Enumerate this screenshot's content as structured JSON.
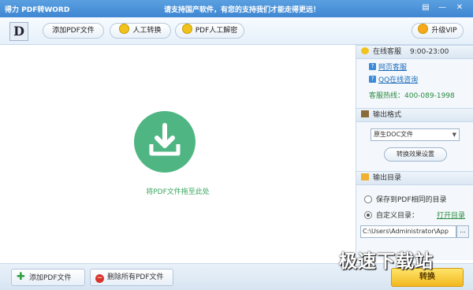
{
  "window": {
    "title": "得力 PDF转WORD",
    "slogan": "请支持国产软件，有您的支持我们才能走得更远！",
    "logo_letter": "D"
  },
  "toolbar": {
    "add_pdf": "添加PDF文件",
    "manual_convert": "人工转换",
    "manual_decrypt": "PDF人工解密",
    "upgrade_vip": "升级VIP"
  },
  "main": {
    "drop_label": "将PDF文件拖至此处",
    "drop_icon": "download-icon"
  },
  "sidebar": {
    "service": {
      "title": "在线客服",
      "hours": "9:00-23:00",
      "web_service": "网页客服",
      "qq_service": "QQ在线咨询",
      "hotline": "客服热线：400-089-1998"
    },
    "format": {
      "title": "输出格式",
      "selected": "原生DOC文件",
      "effect_button": "转换效果设置"
    },
    "output": {
      "title": "输出目录",
      "option_same": "保存到PDF相同的目录",
      "option_custom": "自定义目录：",
      "open_dir": "打开目录",
      "path": "C:\\Users\\Administrator\\App",
      "browse": "..."
    }
  },
  "bottom": {
    "add_pdf": "添加PDF文件",
    "remove_all": "删除所有PDF文件",
    "convert": "转换"
  },
  "watermark": "极速下载站",
  "colors": {
    "title_bar": "#3f86d2",
    "drop_circle": "#4fb683",
    "link": "#1a6bb8",
    "convert_button": "#f2b820"
  }
}
